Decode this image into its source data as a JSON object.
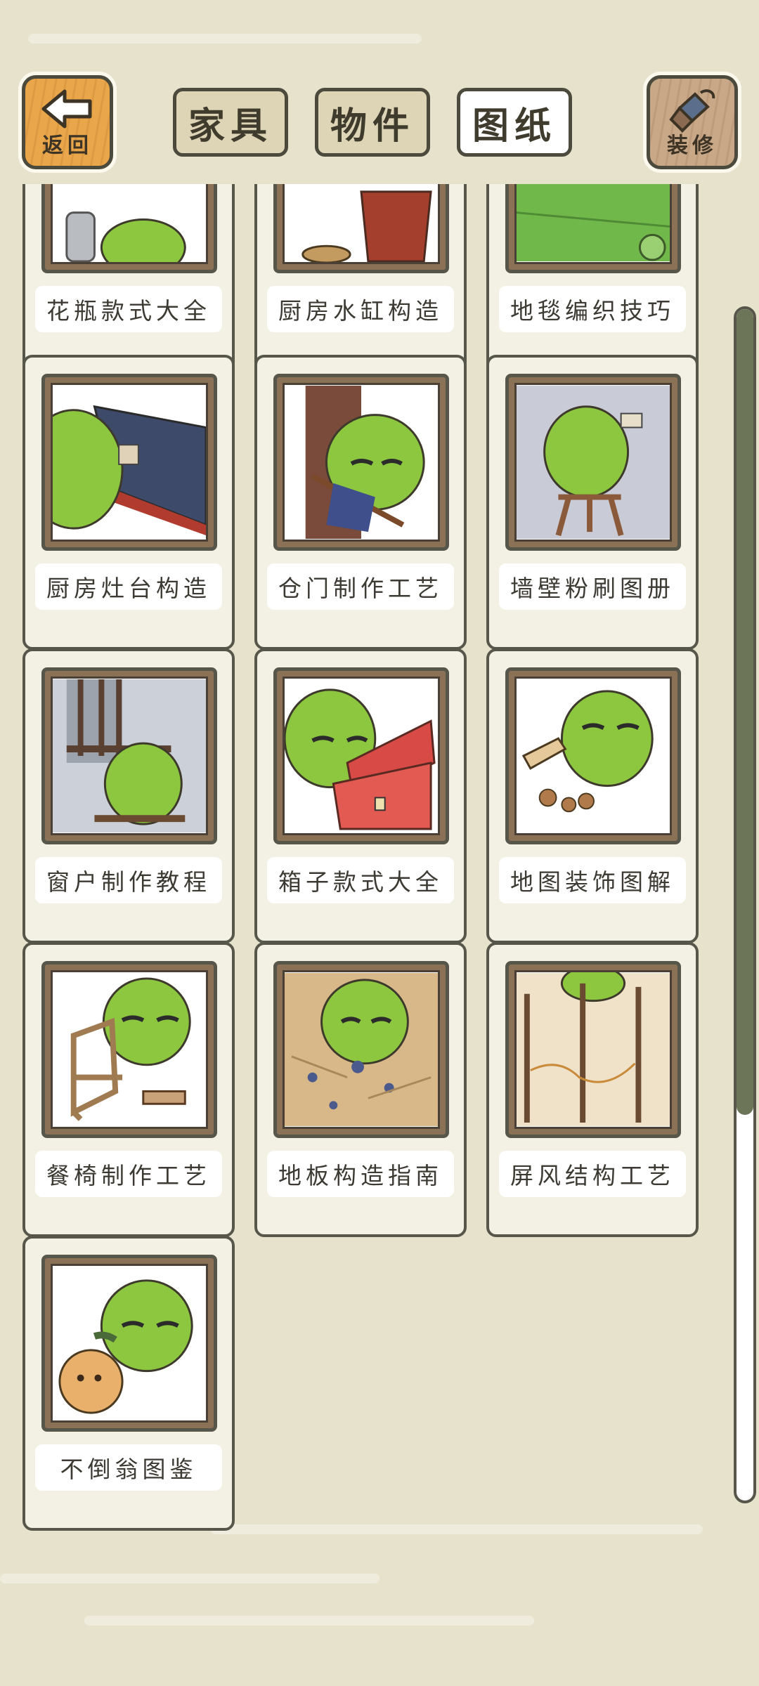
{
  "header": {
    "back_label": "返回",
    "decorate_label": "装修",
    "tabs": [
      {
        "label": "家具",
        "active": false
      },
      {
        "label": "物件",
        "active": false
      },
      {
        "label": "图纸",
        "active": true
      }
    ]
  },
  "catalog": {
    "items": [
      {
        "title": "花瓶款式大全",
        "icon": "vase-picture"
      },
      {
        "title": "厨房水缸构造",
        "icon": "water-jar-picture"
      },
      {
        "title": "地毯编织技巧",
        "icon": "rug-picture"
      },
      {
        "title": "厨房灶台构造",
        "icon": "stove-picture"
      },
      {
        "title": "仓门制作工艺",
        "icon": "door-picture"
      },
      {
        "title": "墙壁粉刷图册",
        "icon": "wall-painting-picture"
      },
      {
        "title": "窗户制作教程",
        "icon": "window-picture"
      },
      {
        "title": "箱子款式大全",
        "icon": "chest-picture"
      },
      {
        "title": "地图装饰图解",
        "icon": "map-picture"
      },
      {
        "title": "餐椅制作工艺",
        "icon": "chair-picture"
      },
      {
        "title": "地板构造指南",
        "icon": "floor-picture"
      },
      {
        "title": "屏风结构工艺",
        "icon": "screen-picture"
      },
      {
        "title": "不倒翁图鉴",
        "icon": "tumbler-picture"
      }
    ]
  },
  "scrollbar": {
    "position_fraction": 0.98,
    "visible_fraction": 0.31
  },
  "colors": {
    "background": "#e6e2cc",
    "frog": "#8dc63f",
    "back_button": "#e9a64a",
    "scroll_thumb": "#6c7558"
  }
}
